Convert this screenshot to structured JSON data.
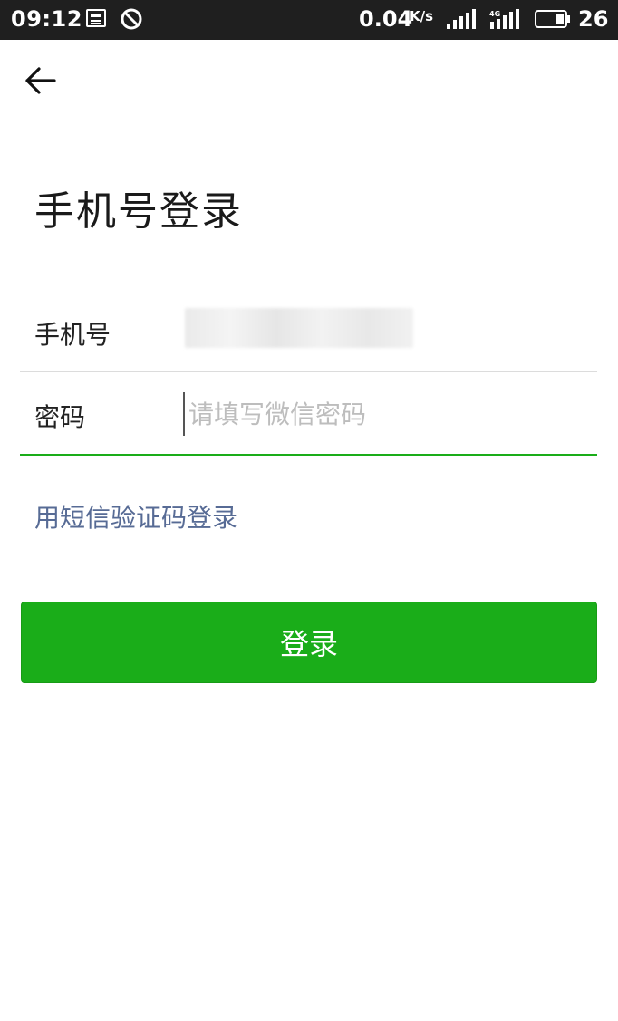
{
  "status_bar": {
    "time": "09:12",
    "net_speed": "0.04",
    "net_speed_unit": "K/s",
    "network_type": "4G",
    "battery": "26",
    "icons": [
      "news-icon",
      "do-not-disturb-icon",
      "signal-icon",
      "4g-signal-icon",
      "battery-icon"
    ]
  },
  "header": {
    "back_icon": "arrow-left-icon",
    "title": "手机号登录"
  },
  "form": {
    "phone_label": "手机号",
    "phone_value": "",
    "password_label": "密码",
    "password_placeholder": "请填写微信密码",
    "password_value": ""
  },
  "links": {
    "sms_login": "用短信验证码登录"
  },
  "actions": {
    "login_label": "登录"
  },
  "colors": {
    "accent_green": "#1aad19",
    "link_blue": "#576b95",
    "status_bar_bg": "#1f1f1f"
  }
}
